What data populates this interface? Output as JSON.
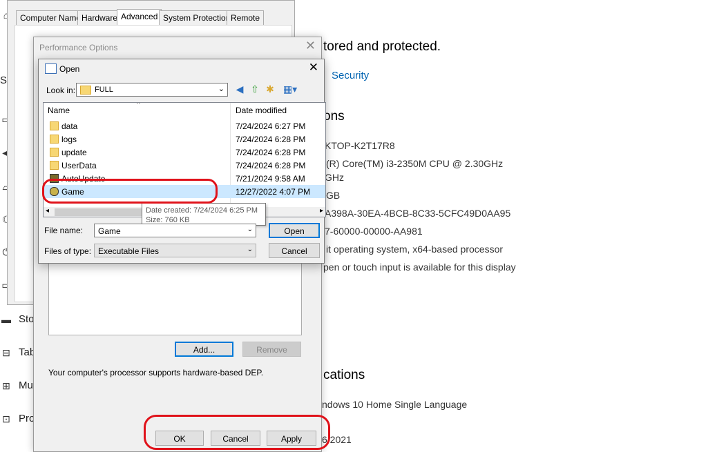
{
  "settings": {
    "heading_protected": "tored and protected.",
    "security_link": "Security",
    "specs_heading": "ons",
    "device_name": "KTOP-K2T17R8",
    "processor": "(R) Core(TM) i3-2350M CPU @ 2.30GHz",
    "processor_line2": "GHz",
    "ram": "GB",
    "device_id": "A398A-30EA-4BCB-8C33-5CFC49D0AA95",
    "product_id": "7-60000-00000-AA981",
    "system_type": "it operating system, x64-based processor",
    "pen_touch": "pen or touch input is available for this display",
    "windows_heading": "cations",
    "edition": "ndows 10 Home Single Language",
    "installed_on": "6 2021",
    "nav": {
      "storage": "Sto",
      "tablet": "Tab",
      "multitasking": "Mu",
      "projecting": "Pro",
      "sys": "Sys"
    }
  },
  "sysprops": {
    "tabs": [
      "Computer Name",
      "Hardware",
      "Advanced",
      "System Protection",
      "Remote"
    ],
    "active_tab": "Advanced"
  },
  "perf": {
    "title": "Performance Options",
    "add_button": "Add...",
    "remove_button": "Remove",
    "dep_text": "Your computer's processor supports hardware-based DEP.",
    "ok_button": "OK",
    "cancel_button": "Cancel",
    "apply_button": "Apply"
  },
  "open": {
    "title": "Open",
    "look_in_label": "Look in:",
    "look_in_value": "FULL",
    "col_name": "Name",
    "col_date": "Date modified",
    "files": [
      {
        "name": "data",
        "date": "7/24/2024 6:27 PM",
        "type": "folder"
      },
      {
        "name": "logs",
        "date": "7/24/2024 6:28 PM",
        "type": "folder"
      },
      {
        "name": "update",
        "date": "7/24/2024 6:28 PM",
        "type": "folder"
      },
      {
        "name": "UserData",
        "date": "7/24/2024 6:28 PM",
        "type": "folder"
      },
      {
        "name": "AutoUpdate",
        "date": "7/21/2024 9:58 AM",
        "type": "exe"
      },
      {
        "name": "Game",
        "date": "12/27/2022 4:07 PM",
        "type": "game",
        "selected": true
      }
    ],
    "tooltip_created": "Date created: 7/24/2024 6:25 PM",
    "tooltip_size": "Size: 760 KB",
    "file_name_label": "File name:",
    "file_name_value": "Game",
    "file_type_label": "Files of type:",
    "file_type_value": "Executable Files",
    "open_button": "Open",
    "cancel_button": "Cancel"
  },
  "colors": {
    "annotation_red": "#e0121a",
    "selection": "#cce8ff",
    "link": "#0063b1"
  }
}
